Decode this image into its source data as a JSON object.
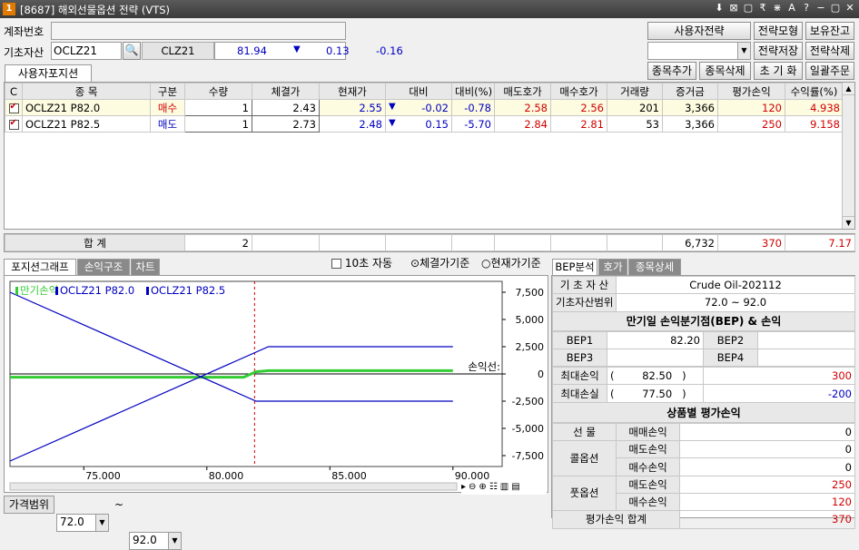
{
  "window": {
    "badge": "1",
    "title": "[8687] 해외선물옵션 전략 (VTS)",
    "controls": [
      "⬇",
      "⊠",
      "▢",
      "₹",
      "⋇",
      "A",
      "?",
      "−",
      "▢",
      "✕"
    ]
  },
  "account": {
    "label": "계좌번호",
    "value": ""
  },
  "underlying": {
    "label": "기초자산",
    "code": "OCLZ21",
    "symbol": "CLZ21",
    "price": "81.94",
    "direction": "▼",
    "change": "0.13",
    "change_pct": "-0.16"
  },
  "buttons": {
    "user_strategy": "사용자전략",
    "strategy_model": "전략모형",
    "holdings": "보유잔고",
    "strategy_save": "전략저장",
    "strategy_delete": "전략삭제",
    "add_item": "종목추가",
    "delete_item": "종목삭제",
    "reset": "초 기 화",
    "bulk_order": "일괄주문"
  },
  "positions_tab": "사용자포지션",
  "grid": {
    "headers": [
      "C",
      "종  목",
      "구분",
      "수량",
      "체결가",
      "현재가",
      "대비",
      "대비(%)",
      "매도호가",
      "매수호가",
      "거래량",
      "증거금",
      "평가손익",
      "수익률(%)"
    ],
    "rows": [
      {
        "checked": true,
        "name": "OCLZ21 P82.0",
        "side": "매수",
        "qty": "1",
        "fill": "2.43",
        "current": "2.55",
        "arrow": "▼",
        "diff": "-0.02",
        "diff_pct": "-0.78",
        "ask": "2.58",
        "bid": "2.56",
        "volume": "201",
        "margin": "3,366",
        "pnl": "120",
        "ret": "4.938"
      },
      {
        "checked": true,
        "name": "OCLZ21 P82.5",
        "side": "매도",
        "qty": "1",
        "fill": "2.73",
        "current": "2.48",
        "arrow": "▼",
        "diff": "0.15",
        "diff_pct": "-5.70",
        "ask": "2.84",
        "bid": "2.81",
        "volume": "53",
        "margin": "3,366",
        "pnl": "250",
        "ret": "9.158"
      }
    ],
    "total": {
      "label": "합    계",
      "qty": "2",
      "margin": "6,732",
      "pnl": "370",
      "ret": "7.17"
    }
  },
  "chart_tabs": [
    "포지션그래프",
    "손익구조",
    "차트"
  ],
  "options": {
    "auto10": "10초 자동",
    "fill_basis": "체결가기준",
    "current_basis": "현재가기준"
  },
  "chart_data": {
    "type": "line",
    "legend": [
      "만기손익",
      "OCLZ21 P82.0",
      "OCLZ21 P82.5"
    ],
    "xlim": [
      72.0,
      92.0
    ],
    "ylim": [
      -8500,
      8500
    ],
    "xticks": [
      75,
      80,
      85,
      90
    ],
    "xtick_labels": [
      "75.000",
      "80.000",
      "85.000",
      "90.000"
    ],
    "yticks": [
      7500,
      5000,
      2500,
      0,
      -2500,
      -5000,
      -7500
    ],
    "ytick_labels": [
      "7,500",
      "5,000",
      "2,500",
      "0",
      "-2,500",
      "-5,000",
      "-7,500"
    ],
    "current_price_marker": 81.94,
    "annotation": "손익선:",
    "series": [
      {
        "name": "만기손익",
        "color": "#33cc33",
        "x": [
          72,
          81.5,
          82,
          82.5,
          90
        ],
        "y": [
          -300,
          -300,
          200,
          300,
          300
        ]
      },
      {
        "name": "OCLZ21 P82.0",
        "color": "#0000c0",
        "x": [
          72,
          82,
          90
        ],
        "y": [
          7500,
          -2500,
          -2500
        ]
      },
      {
        "name": "OCLZ21 P82.5",
        "color": "#0000c0",
        "x": [
          72,
          82.5,
          90
        ],
        "y": [
          -8000,
          2500,
          2500
        ]
      }
    ]
  },
  "price_range": {
    "label": "가격범위",
    "from": "72.0",
    "sep": "~",
    "to": "92.0"
  },
  "right_tabs": [
    "BEP분석",
    "호가",
    "종목상세"
  ],
  "bep": {
    "underlying_label": "기 초 자 산",
    "underlying_value": "Crude Oil-202112",
    "range_label": "기초자산범위",
    "range_value": "72.0 ~ 92.0",
    "section_title": "만기일 손익분기점(BEP) & 손익",
    "bep1_label": "BEP1",
    "bep1": "82.20",
    "bep2_label": "BEP2",
    "bep2": "",
    "bep3_label": "BEP3",
    "bep3": "",
    "bep4_label": "BEP4",
    "bep4": "",
    "max_profit_label": "최대손익",
    "max_profit_price": "82.50",
    "max_profit": "300",
    "max_loss_label": "최대손실",
    "max_loss_price": "77.50",
    "max_loss": "-200",
    "eval_title": "상품별 평가손익",
    "futures_label": "선  물",
    "trade_pnl_label": "매매손익",
    "futures_pnl": "0",
    "call_label": "콜옵션",
    "sell_pnl_label": "매도손익",
    "buy_pnl_label": "매수손익",
    "call_sell": "0",
    "call_buy": "0",
    "put_label": "풋옵션",
    "put_sell": "250",
    "put_buy": "120",
    "total_label": "평가손익 합계",
    "total": "370"
  }
}
